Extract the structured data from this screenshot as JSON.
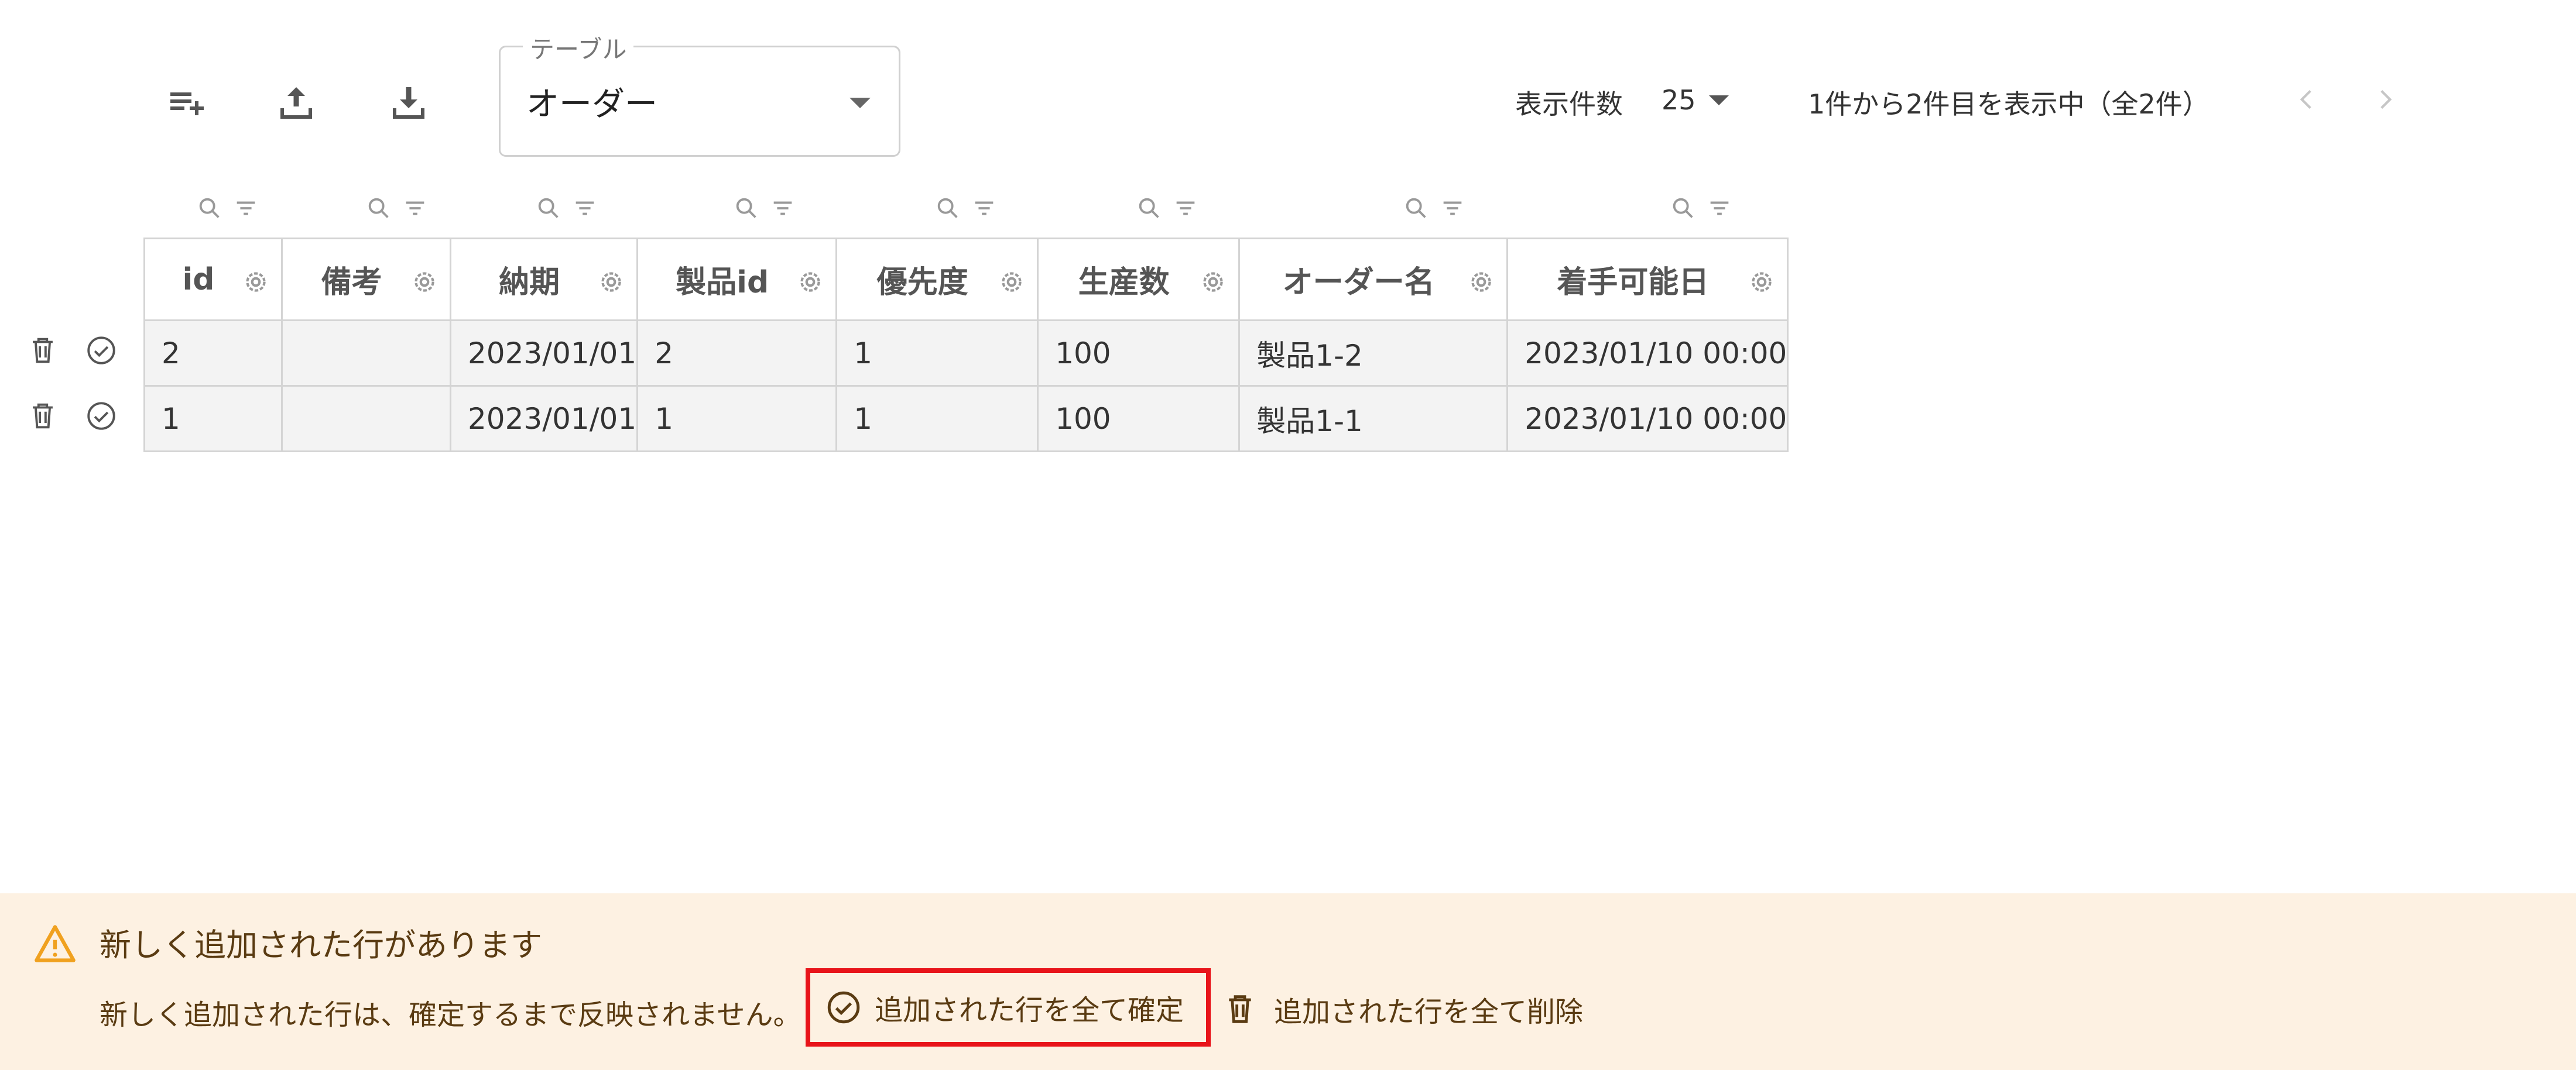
{
  "toolbar": {
    "add_row_icon": "playlist-add-icon",
    "upload_icon": "upload-icon",
    "download_icon": "download-icon"
  },
  "table_select": {
    "legend": "テーブル",
    "value": "オーダー"
  },
  "pagination": {
    "rows_label": "表示件数",
    "rows_value": "25",
    "range_text": "1件から2件目を表示中（全2件）"
  },
  "columns": [
    {
      "label": "id"
    },
    {
      "label": "備考"
    },
    {
      "label": "納期"
    },
    {
      "label": "製品id"
    },
    {
      "label": "優先度"
    },
    {
      "label": "生産数"
    },
    {
      "label": "オーダー名"
    },
    {
      "label": "着手可能日"
    }
  ],
  "rows": [
    {
      "id": "2",
      "note": "",
      "due": "2023/01/01",
      "product_id": "2",
      "priority": "1",
      "qty": "100",
      "order_name": "製品1-2",
      "start": "2023/01/10 00:00"
    },
    {
      "id": "1",
      "note": "",
      "due": "2023/01/01",
      "product_id": "1",
      "priority": "1",
      "qty": "100",
      "order_name": "製品1-1",
      "start": "2023/01/10 00:00"
    }
  ],
  "banner": {
    "title": "新しく追加された行があります",
    "message": "新しく追加された行は、確定するまで反映されません。",
    "confirm_all_label": "追加された行を全て確定",
    "delete_all_label": "追加された行を全て削除",
    "background": "#fdf1e2",
    "highlight": "#e8141a",
    "warning_color": "#f0a11f"
  }
}
